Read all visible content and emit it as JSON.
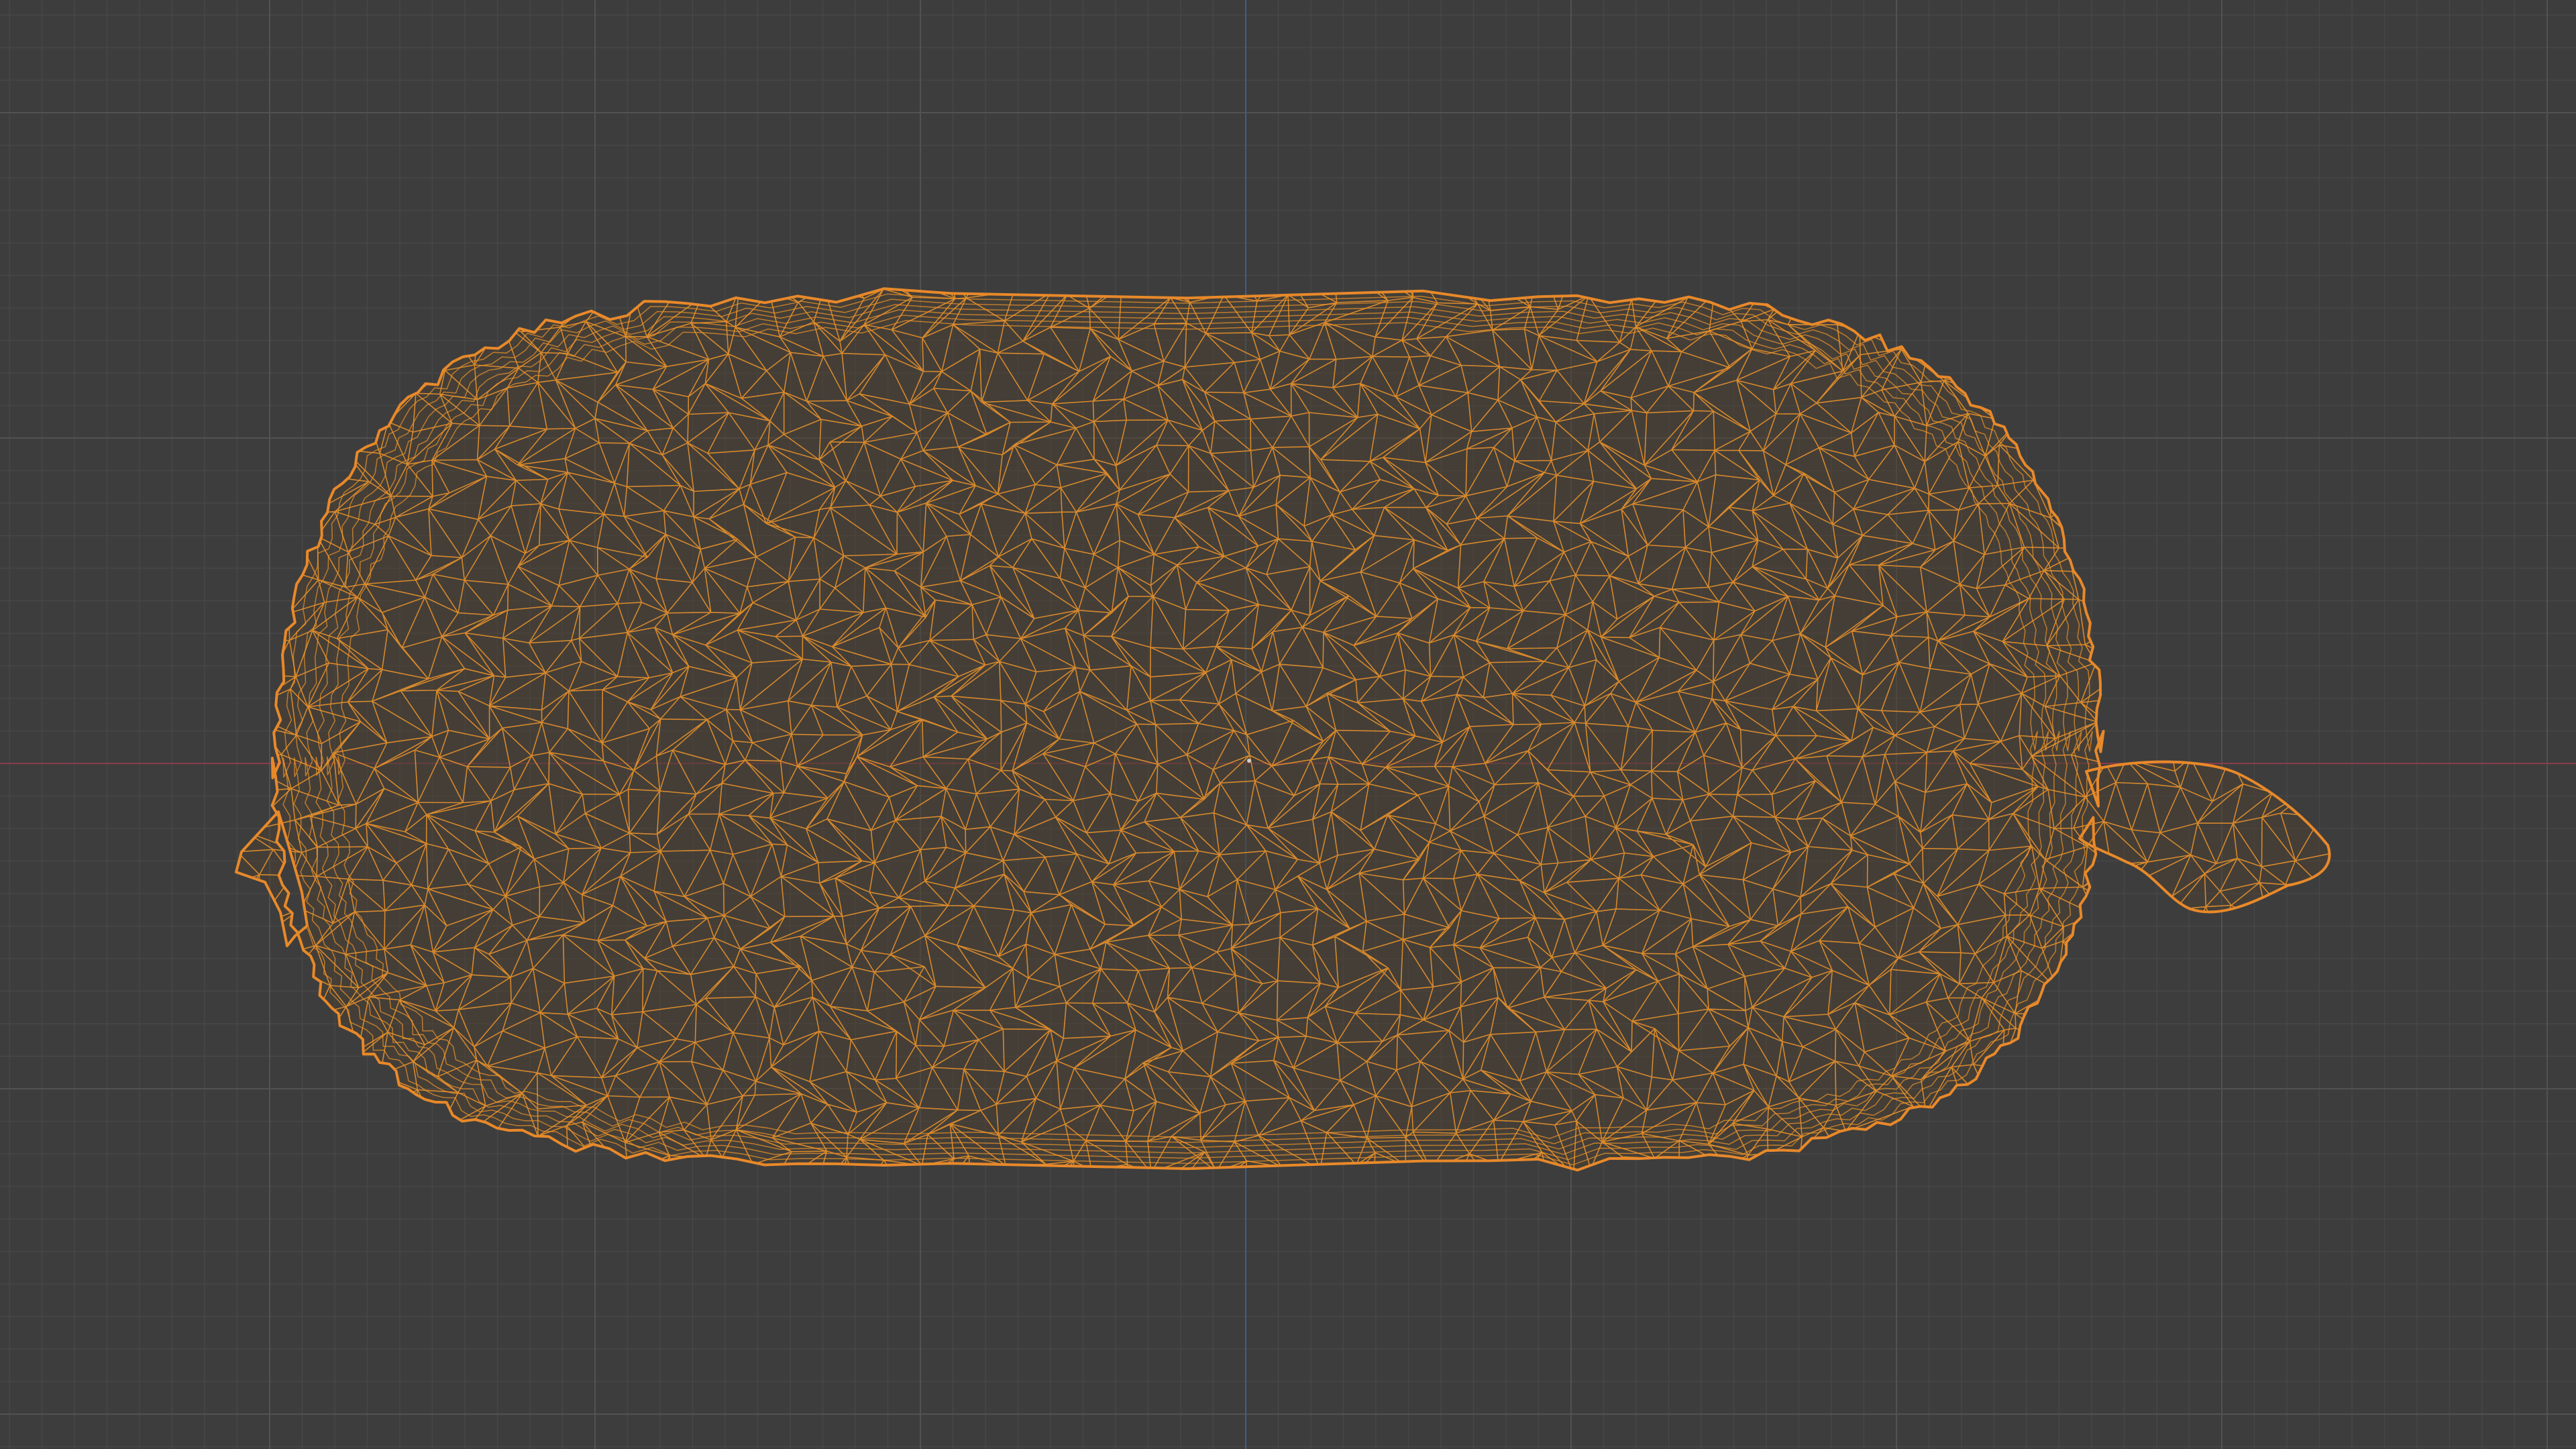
{
  "viewport": {
    "mode": "wireframe",
    "colors": {
      "background": "#3d3d3d",
      "grid_minor": "#474747",
      "grid_major": "#525252",
      "axis_x": "#8a3d4a",
      "axis_y": "#3f5f87",
      "wire": "#f0952a",
      "wire_edge": "#e8892a",
      "fill_tint": "#4a3f33"
    },
    "object": {
      "name": "",
      "shape": "elongated-oval-with-stem"
    }
  }
}
